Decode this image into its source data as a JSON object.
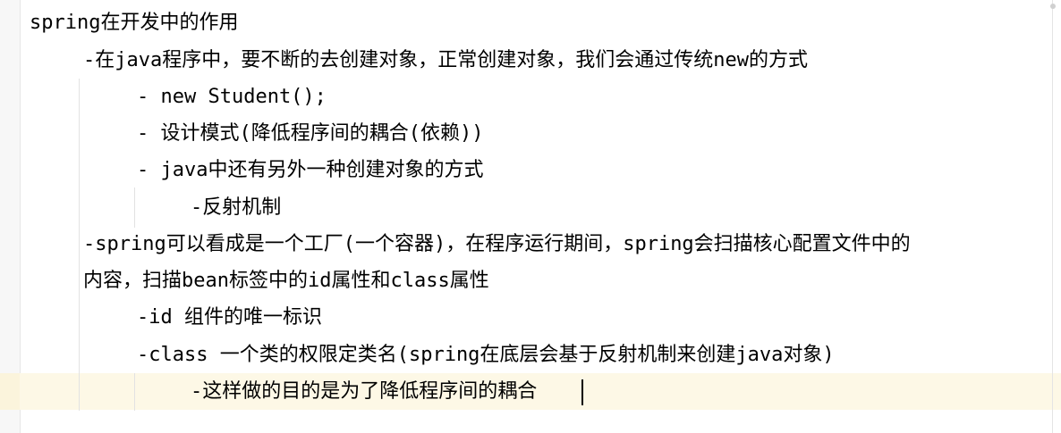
{
  "editor": {
    "lines": [
      "spring在开发中的作用",
      "-在java程序中，要不断的去创建对象，正常创建对象，我们会通过传统new的方式",
      "- new Student();",
      "- 设计模式(降低程序间的耦合(依赖))",
      "- java中还有另外一种创建对象的方式",
      "-反射机制",
      "-spring可以看成是一个工厂(一个容器)，在程序运行期间，spring会扫描核心配置文件中的",
      "内容，扫描bean标签中的id属性和class属性",
      "-id 组件的唯一标识",
      "-class 一个类的权限定类名(spring在底层会基于反射机制来创建java对象)",
      "-这样做的目的是为了降低程序间的耦合"
    ]
  }
}
